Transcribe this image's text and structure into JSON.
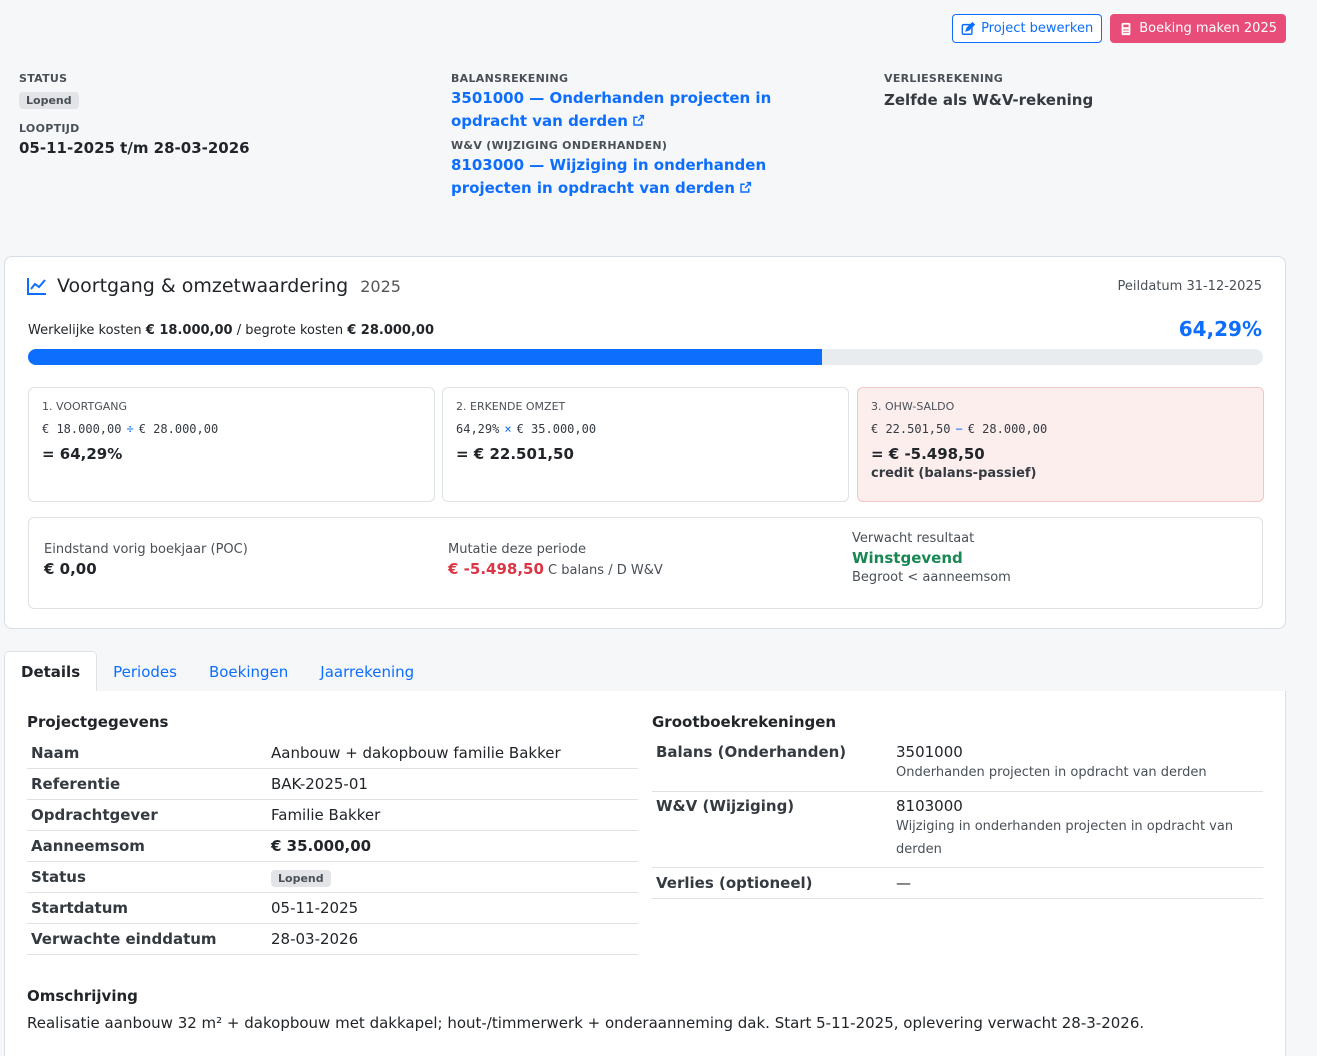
{
  "actions": {
    "edit_label": "Project bewerken",
    "booking_label": "Boeking maken 2025"
  },
  "info": {
    "status_label": "STATUS",
    "status_value": "Lopend",
    "looptijd_label": "LOOPTIJD",
    "looptijd_value": "05-11-2025 t/m 28-03-2026",
    "balans_label": "BALANSREKENING",
    "balans_link": "3501000 — Onderhanden projecten in opdracht van derden",
    "wv_label": "W&V (WIJZIGING ONDERHANDEN)",
    "wv_link": "8103000 — Wijziging in onderhanden projecten in opdracht van derden",
    "verlies_label": "VERLIESREKENING",
    "verlies_value": "Zelfde als W&V-rekening"
  },
  "progress": {
    "title": "Voortgang & omzetwaardering",
    "year": "2025",
    "peildatum": "Peildatum 31-12-2025",
    "kosten_prefix": "Werkelijke kosten ",
    "werkelijk": "€ 18.000,00",
    "kosten_mid": " / begrote kosten ",
    "begroot": "€ 28.000,00",
    "percentage": "64,29%",
    "fill_fraction": 0.6429,
    "cards": [
      {
        "label": "1. VOORTGANG",
        "a": "€ 18.000,00",
        "op": "÷",
        "b": "€ 28.000,00",
        "result": "= 64,29%",
        "sub": ""
      },
      {
        "label": "2. ERKENDE OMZET",
        "a": "64,29%",
        "op": "×",
        "b": "€ 35.000,00",
        "result": "= € 22.501,50",
        "sub": ""
      },
      {
        "label": "3. OHW-SALDO",
        "a": "€ 22.501,50",
        "op": "−",
        "b": "€ 28.000,00",
        "result": "= € -5.498,50",
        "sub": "credit (balans-passief)"
      }
    ],
    "summary": {
      "eind_label": "Eindstand vorig boekjaar (POC)",
      "eind_value": "€ 0,00",
      "mutatie_label": "Mutatie deze periode",
      "mutatie_value": "€ -5.498,50",
      "mutatie_note": " C balans / D W&V",
      "resultaat_label": "Verwacht resultaat",
      "resultaat_value": "Winstgevend",
      "resultaat_note": "Begroot < aanneemsom"
    }
  },
  "tabs": [
    "Details",
    "Periodes",
    "Boekingen",
    "Jaarrekening"
  ],
  "details": {
    "project_title": "Projectgegevens",
    "rows": [
      {
        "k": "Naam",
        "v": "Aanbouw + dakopbouw familie Bakker"
      },
      {
        "k": "Referentie",
        "v": "BAK-2025-01"
      },
      {
        "k": "Opdrachtgever",
        "v": "Familie Bakker"
      },
      {
        "k": "Aanneemsom",
        "v": "€ 35.000,00"
      },
      {
        "k": "Status",
        "v": "Lopend"
      },
      {
        "k": "Startdatum",
        "v": "05-11-2025"
      },
      {
        "k": "Verwachte einddatum",
        "v": "28-03-2026"
      }
    ],
    "gb_title": "Grootboekrekeningen",
    "gb_rows": [
      {
        "k": "Balans (Onderhanden)",
        "v": "3501000",
        "d": "Onderhanden projecten in opdracht van derden"
      },
      {
        "k": "W&V (Wijziging)",
        "v": "8103000",
        "d": "Wijziging in onderhanden projecten in opdracht van derden"
      },
      {
        "k": "Verlies (optioneel)",
        "v": "—",
        "d": ""
      }
    ],
    "omschrijving_title": "Omschrijving",
    "omschrijving": "Realisatie aanbouw 32 m² + dakopbouw met dakkapel; hout-/timmerwerk + onderaanneming dak. Start 5-11-2025, oplevering verwacht 28-3-2026."
  }
}
